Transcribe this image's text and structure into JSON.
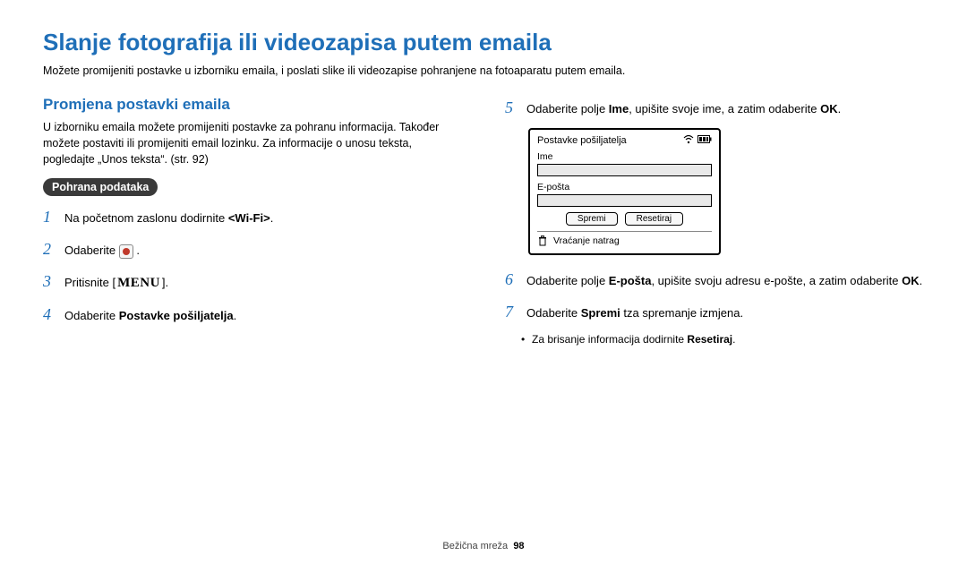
{
  "title": "Slanje fotografija ili videozapisa putem emaila",
  "intro": "Možete promijeniti postavke u izborniku emaila, i poslati slike ili videozapise pohranjene na fotoaparatu putem emaila.",
  "left": {
    "subhead": "Promjena postavki emaila",
    "subtext": "U izborniku emaila možete promijeniti postavke za pohranu informacija. Također možete postaviti ili promijeniti email lozinku. Za informacije o unosu teksta, pogledajte „Unos teksta“. (str. 92)",
    "pill": "Pohrana podataka",
    "steps": {
      "s1a": "Na početnom zaslonu dodirnite ",
      "s1b": "<Wi-Fi>",
      "s1c": ".",
      "s2a": "Odaberite ",
      "s2b": " .",
      "s3a": "Pritisnite [",
      "s3menu": "MENU",
      "s3b": "].",
      "s4a": "Odaberite ",
      "s4b": "Postavke pošiljatelja",
      "s4c": "."
    }
  },
  "right": {
    "s5a": "Odaberite polje ",
    "s5b": "Ime",
    "s5c": ", upišite svoje ime, a zatim odaberite ",
    "s5d": "OK",
    "s5e": ".",
    "device": {
      "title": "Postavke pošiljatelja",
      "f1": "Ime",
      "f2": "E-pošta",
      "btn1": "Spremi",
      "btn2": "Resetiraj",
      "footer": "Vraćanje natrag"
    },
    "s6a": "Odaberite polje ",
    "s6b": "E-pošta",
    "s6c": ", upišite svoju adresu e-pošte, a zatim odaberite ",
    "s6d": "OK",
    "s6e": ".",
    "s7a": "Odaberite ",
    "s7b": "Spremi",
    "s7c": " tza spremanje izmjena.",
    "bullet_a": "Za brisanje informacija dodirnite ",
    "bullet_b": "Resetiraj",
    "bullet_c": "."
  },
  "footer": {
    "section": "Bežična mreža",
    "page": "98"
  }
}
